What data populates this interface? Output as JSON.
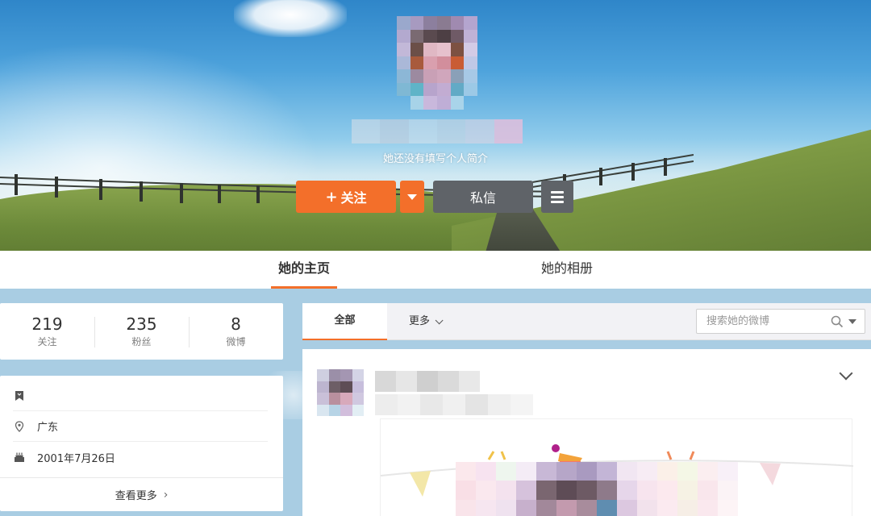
{
  "profile": {
    "bio": "她还没有填写个人简介",
    "follow_label": "关注",
    "follow_plus": "+",
    "message_label": "私信"
  },
  "tabs": [
    {
      "label": "她的主页",
      "active": true
    },
    {
      "label": "她的相册",
      "active": false
    }
  ],
  "stats": [
    {
      "value": "219",
      "label": "关注"
    },
    {
      "value": "235",
      "label": "粉丝"
    },
    {
      "value": "8",
      "label": "微博"
    }
  ],
  "info": {
    "location": "广东",
    "birthday": "2001年7月26日",
    "more_label": "查看更多",
    "more_chevron": "›"
  },
  "feed_filter": {
    "all_label": "全部",
    "more_label": "更多"
  },
  "search": {
    "placeholder": "搜索她的微博"
  },
  "colors": {
    "accent": "#f36f2a",
    "dark_button": "#5f6368",
    "page_bg": "#a9cde3"
  }
}
